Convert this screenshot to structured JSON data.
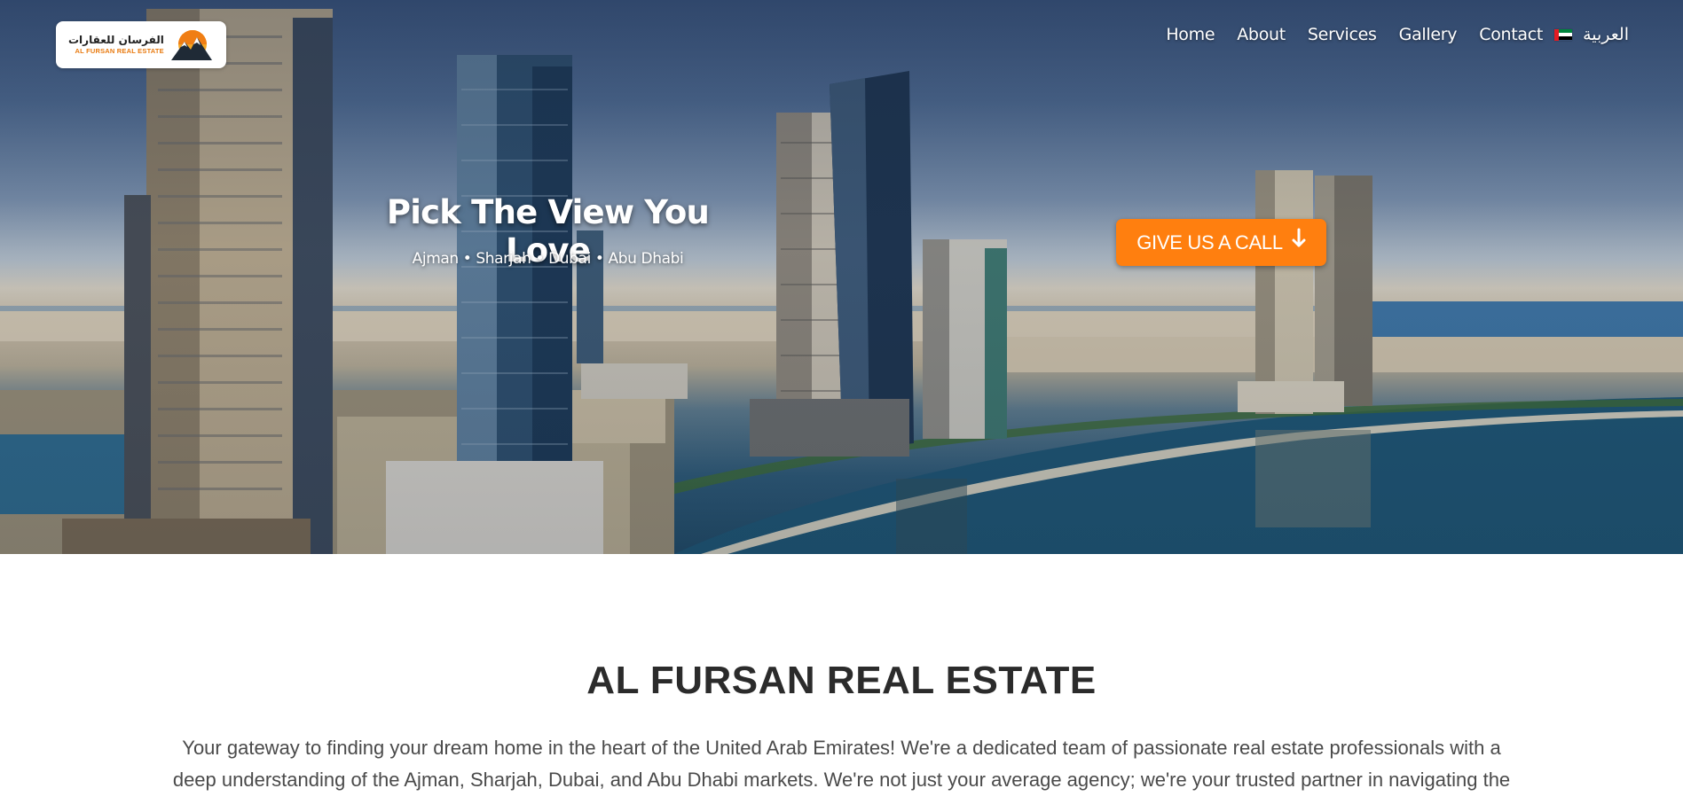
{
  "logo": {
    "arabic_text": "الفرسان للعقارات",
    "english_text": "AL FURSAN REAL ESTATE"
  },
  "nav": {
    "items": [
      "Home",
      "About",
      "Services",
      "Gallery",
      "Contact"
    ],
    "language_label": "العربية",
    "language_flag_icon": "uae-flag-icon"
  },
  "hero": {
    "title": "Pick The View You Love",
    "subtitle": "Ajman • Sharjah • Dubai • Abu Dhabi",
    "cta_label": "GIVE US A CALL",
    "cta_icon": "arrow-down-icon"
  },
  "about": {
    "title": "AL FURSAN REAL ESTATE",
    "text": "Your gateway to finding your dream home in the heart of the United Arab Emirates! We're a dedicated team of passionate real estate professionals with a deep understanding of the Ajman, Sharjah, Dubai, and Abu Dhabi markets. We're not just your average agency; we're your trusted partner in navigating the exciting world of UAE real estate."
  },
  "colors": {
    "accent": "#ff7f0f",
    "text_dark": "#2b2b2b",
    "text_body": "#4a4a4a",
    "nav_text": "#ffffff"
  }
}
